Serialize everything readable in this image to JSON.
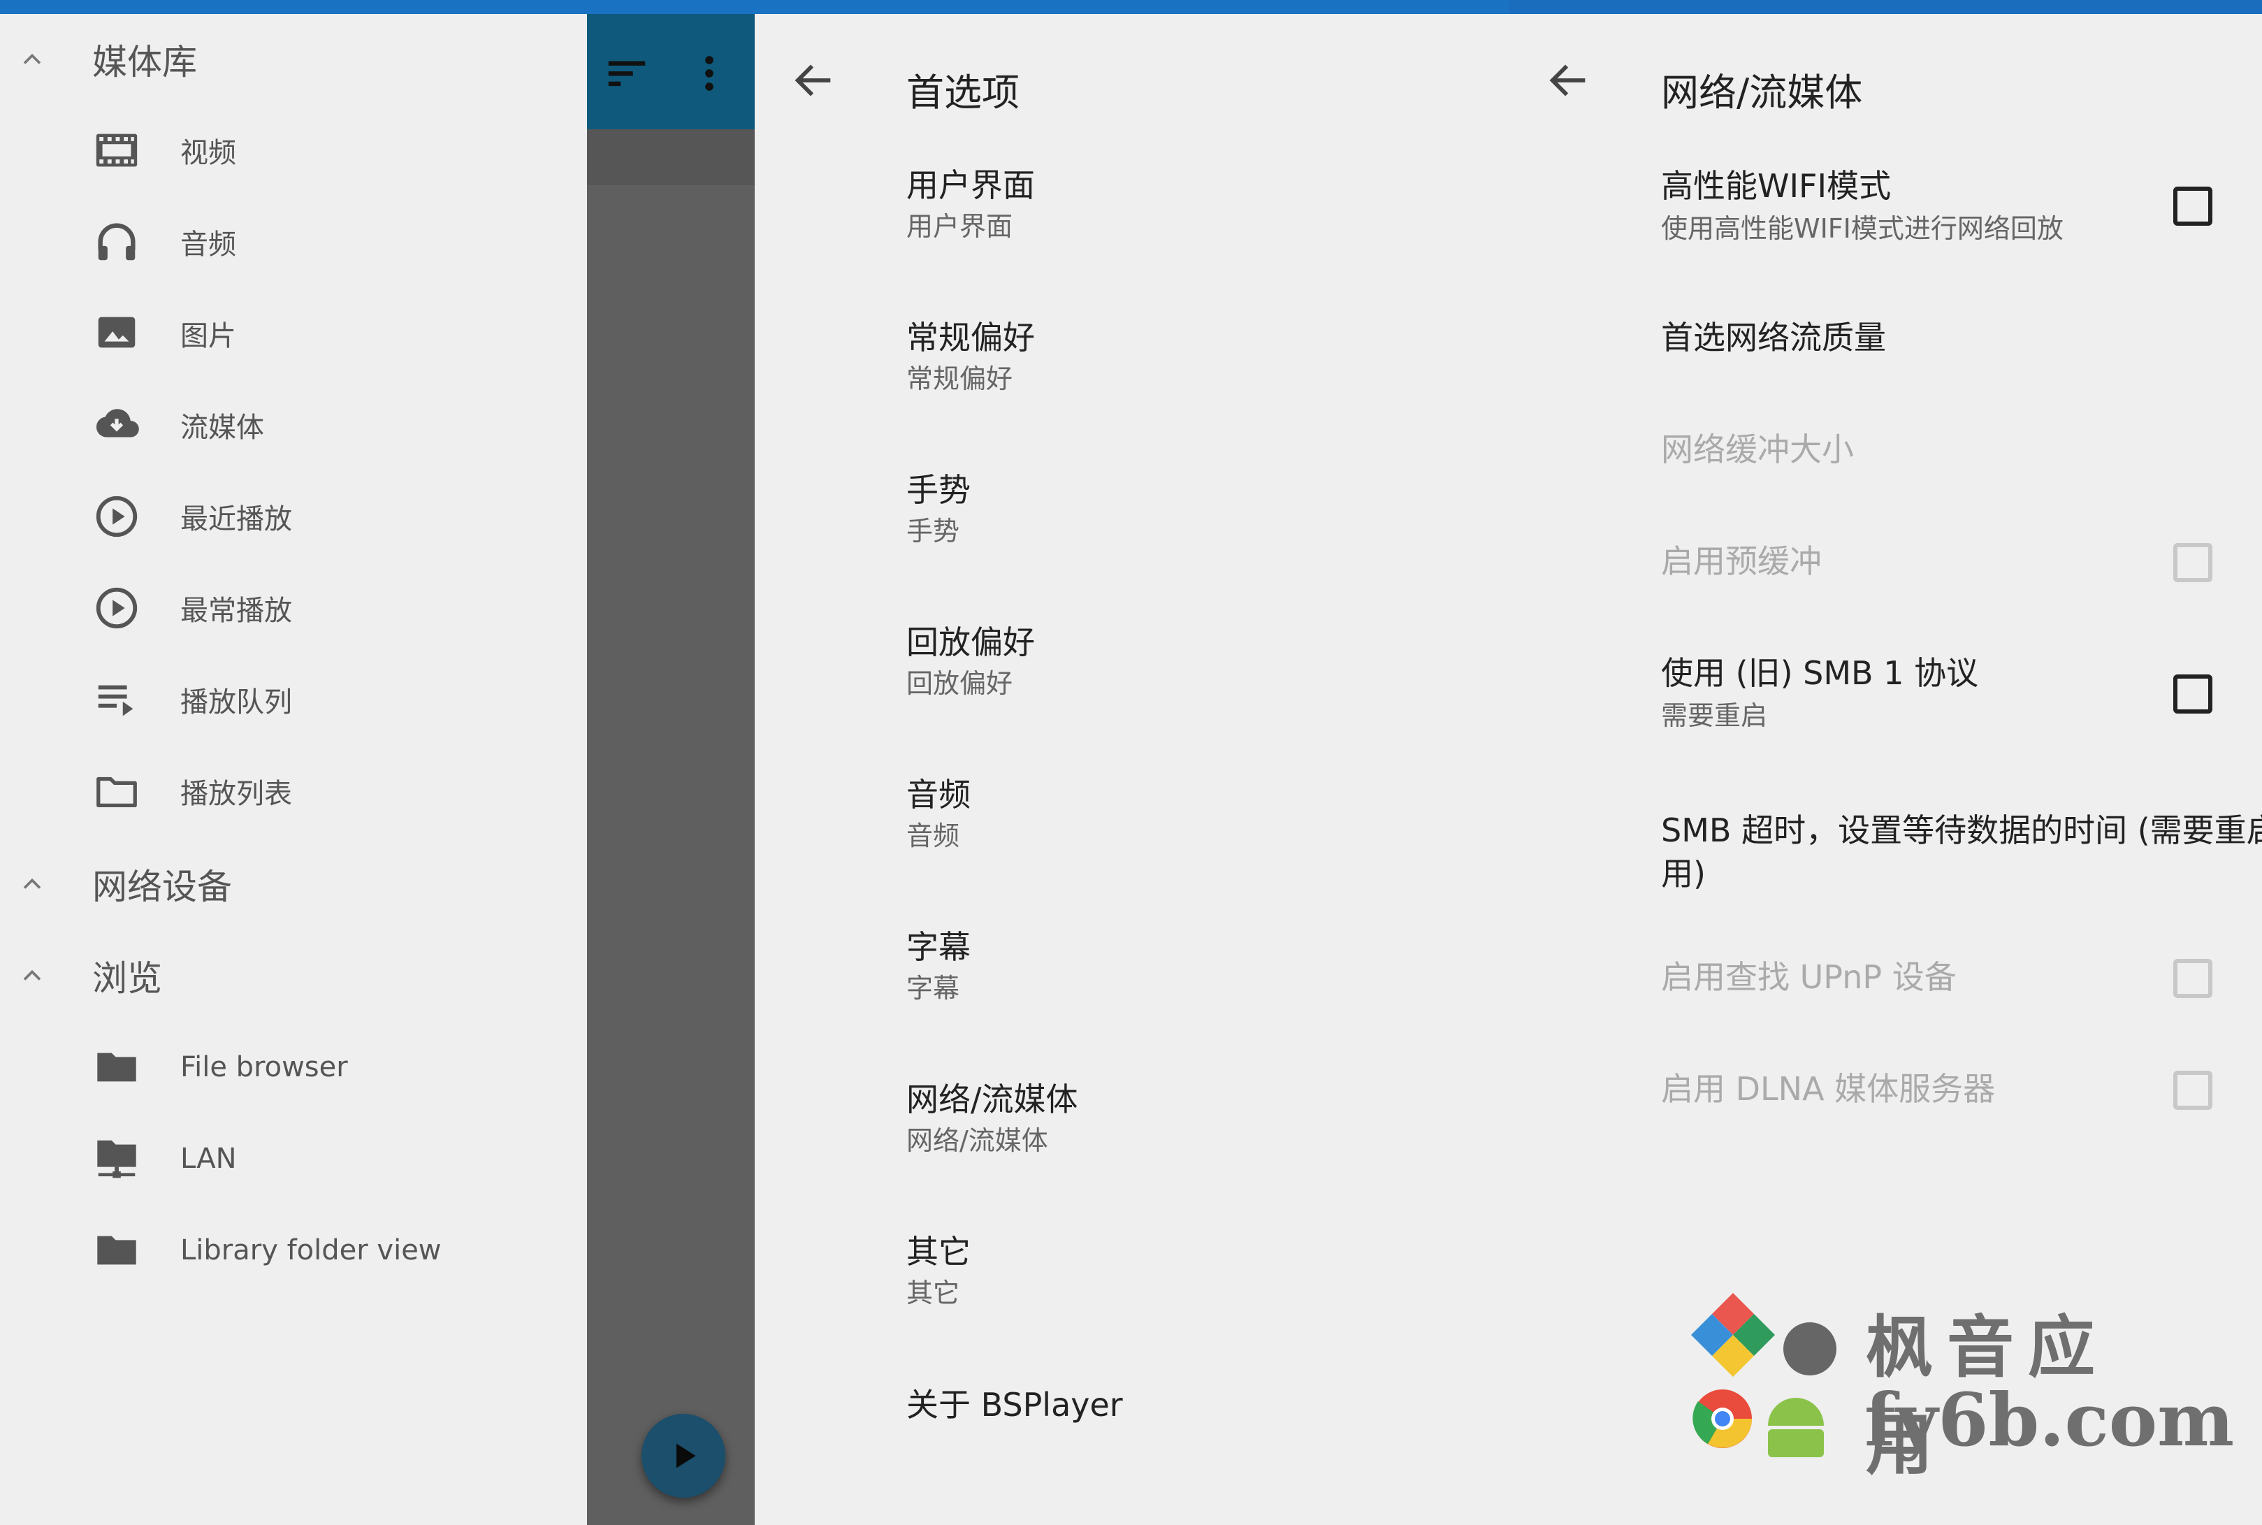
{
  "drawer": {
    "media_library": {
      "label": "媒体库"
    },
    "media_items": [
      {
        "label": "视频",
        "icon": "video-icon"
      },
      {
        "label": "音频",
        "icon": "headphones-icon"
      },
      {
        "label": "图片",
        "icon": "image-icon"
      },
      {
        "label": "流媒体",
        "icon": "cloud-download-icon"
      },
      {
        "label": "最近播放",
        "icon": "play-circle-icon"
      },
      {
        "label": "最常播放",
        "icon": "play-circle-icon"
      },
      {
        "label": "播放队列",
        "icon": "queue-icon"
      },
      {
        "label": "播放列表",
        "icon": "folder-outline-icon"
      }
    ],
    "network_devices": {
      "label": "网络设备"
    },
    "browse": {
      "label": "浏览"
    },
    "browse_items": [
      {
        "label": "File browser",
        "icon": "folder-icon"
      },
      {
        "label": "LAN",
        "icon": "network-folder-icon"
      },
      {
        "label": "Library folder view",
        "icon": "folder-icon"
      }
    ]
  },
  "preferences": {
    "title": "首选项",
    "items": [
      {
        "title": "用户界面",
        "subtitle": "用户界面"
      },
      {
        "title": "常规偏好",
        "subtitle": "常规偏好"
      },
      {
        "title": "手势",
        "subtitle": "手势"
      },
      {
        "title": "回放偏好",
        "subtitle": "回放偏好"
      },
      {
        "title": "音频",
        "subtitle": "音频"
      },
      {
        "title": "字幕",
        "subtitle": "字幕"
      },
      {
        "title": "网络/流媒体",
        "subtitle": "网络/流媒体"
      },
      {
        "title": "其它",
        "subtitle": "其它"
      },
      {
        "title": "关于 BSPlayer"
      }
    ]
  },
  "network": {
    "title": "网络/流媒体",
    "items": [
      {
        "title": "高性能WIFI模式",
        "subtitle": "使用高性能WIFI模式进行网络回放",
        "checkbox": true,
        "checked": false,
        "enabled": true
      },
      {
        "title": "首选网络流质量",
        "enabled": true
      },
      {
        "title": "网络缓冲大小",
        "enabled": false
      },
      {
        "title": "启用预缓冲",
        "checkbox": true,
        "checked": false,
        "enabled": false
      },
      {
        "title": "使用 (旧) SMB 1 协议",
        "subtitle": "需要重启",
        "checkbox": true,
        "checked": false,
        "enabled": true
      },
      {
        "title": "SMB 超时，设置等待数据的时间 (需要重启应用)",
        "enabled": true
      },
      {
        "title": "启用查找 UPnP 设备",
        "checkbox": true,
        "checked": false,
        "enabled": false
      },
      {
        "title": "启用 DLNA 媒体服务器",
        "checkbox": true,
        "checked": false,
        "enabled": false
      }
    ]
  },
  "watermark": {
    "line1": "枫音应用",
    "line2": "fy6b.com"
  },
  "colors": {
    "toolbar": "#0f5a7c",
    "accent": "#1a73c2",
    "fab": "#1b4f6b"
  }
}
